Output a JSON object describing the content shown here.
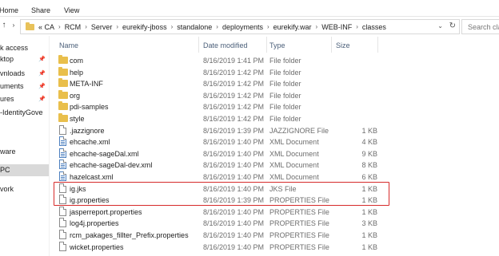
{
  "ribbon": {
    "home": "Home",
    "share": "Share",
    "view": "View"
  },
  "address": {
    "crumbs": [
      "« CA",
      "RCM",
      "Server",
      "eurekify-jboss",
      "standalone",
      "deployments",
      "eurekify.war",
      "WEB-INF",
      "classes"
    ],
    "search_placeholder": "Search clas"
  },
  "nav_pane": [
    {
      "label": "k access",
      "pinned": false
    },
    {
      "label": "ktop",
      "pinned": true
    },
    {
      "label": "vnloads",
      "pinned": true
    },
    {
      "label": "uments",
      "pinned": true
    },
    {
      "label": "ures",
      "pinned": true
    },
    {
      "label": "-IdentityGove",
      "pinned": false
    },
    {
      "label": "ware",
      "pinned": false
    },
    {
      "label": "PC",
      "pinned": false
    },
    {
      "label": "vork",
      "pinned": false
    }
  ],
  "columns": {
    "name": "Name",
    "date": "Date modified",
    "type": "Type",
    "size": "Size"
  },
  "files": [
    {
      "name": "com",
      "date": "8/16/2019 1:41 PM",
      "type": "File folder",
      "size": "",
      "icon": "folder-icon"
    },
    {
      "name": "help",
      "date": "8/16/2019 1:42 PM",
      "type": "File folder",
      "size": "",
      "icon": "folder-icon"
    },
    {
      "name": "META-INF",
      "date": "8/16/2019 1:42 PM",
      "type": "File folder",
      "size": "",
      "icon": "folder-icon"
    },
    {
      "name": "org",
      "date": "8/16/2019 1:42 PM",
      "type": "File folder",
      "size": "",
      "icon": "folder-icon"
    },
    {
      "name": "pdi-samples",
      "date": "8/16/2019 1:42 PM",
      "type": "File folder",
      "size": "",
      "icon": "folder-icon"
    },
    {
      "name": "style",
      "date": "8/16/2019 1:42 PM",
      "type": "File folder",
      "size": "",
      "icon": "folder-icon"
    },
    {
      "name": ".jazzignore",
      "date": "8/16/2019 1:39 PM",
      "type": "JAZZIGNORE File",
      "size": "1 KB",
      "icon": "file-icon"
    },
    {
      "name": "ehcache.xml",
      "date": "8/16/2019 1:40 PM",
      "type": "XML Document",
      "size": "4 KB",
      "icon": "xml-file-icon"
    },
    {
      "name": "ehcache-sageDal.xml",
      "date": "8/16/2019 1:40 PM",
      "type": "XML Document",
      "size": "9 KB",
      "icon": "xml-file-icon"
    },
    {
      "name": "ehcache-sageDal-dev.xml",
      "date": "8/16/2019 1:40 PM",
      "type": "XML Document",
      "size": "8 KB",
      "icon": "xml-file-icon"
    },
    {
      "name": "hazelcast.xml",
      "date": "8/16/2019 1:40 PM",
      "type": "XML Document",
      "size": "6 KB",
      "icon": "xml-file-icon"
    },
    {
      "name": "ig.jks",
      "date": "8/16/2019 1:40 PM",
      "type": "JKS File",
      "size": "1 KB",
      "icon": "file-icon"
    },
    {
      "name": "ig.properties",
      "date": "8/16/2019 1:39 PM",
      "type": "PROPERTIES File",
      "size": "1 KB",
      "icon": "file-icon"
    },
    {
      "name": "jasperreport.properties",
      "date": "8/16/2019 1:40 PM",
      "type": "PROPERTIES File",
      "size": "1 KB",
      "icon": "file-icon"
    },
    {
      "name": "log4j.properties",
      "date": "8/16/2019 1:40 PM",
      "type": "PROPERTIES File",
      "size": "3 KB",
      "icon": "file-icon"
    },
    {
      "name": "rcm_pakages_fillter_Prefix.properties",
      "date": "8/16/2019 1:40 PM",
      "type": "PROPERTIES File",
      "size": "1 KB",
      "icon": "file-icon"
    },
    {
      "name": "wicket.properties",
      "date": "8/16/2019 1:40 PM",
      "type": "PROPERTIES File",
      "size": "1 KB",
      "icon": "file-icon"
    }
  ],
  "colors": {
    "highlight_box": "#d62a2a",
    "header_text": "#4c607a",
    "folder": "#e9bf4c",
    "selected_nav": "#d9d9d9"
  }
}
